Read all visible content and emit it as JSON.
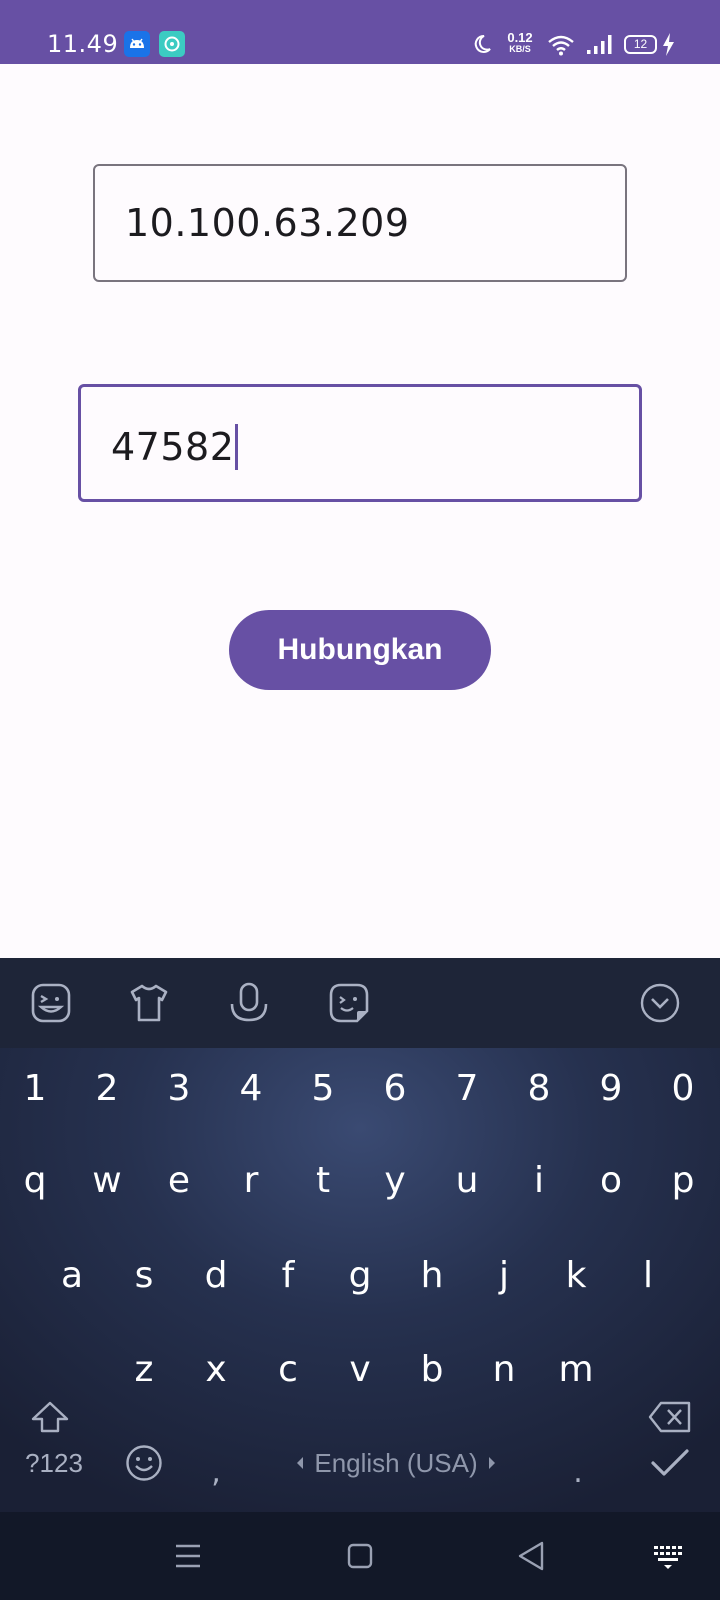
{
  "status_bar": {
    "time": "11.49",
    "net_speed_value": "0.12",
    "net_speed_unit": "KB/S",
    "battery_level": "12",
    "icons": [
      "android-notification-icon",
      "app-notification-icon",
      "moon-icon",
      "wifi-icon",
      "signal-icon",
      "battery-icon",
      "charging-icon"
    ]
  },
  "form": {
    "ip_value": "10.100.63.209",
    "port_value": "47582",
    "connect_label": "Hubungkan"
  },
  "keyboard": {
    "toolbar_icons": [
      "sticker-icon",
      "theme-icon",
      "microphone-icon",
      "emoji-sticker-icon",
      "collapse-keyboard-icon"
    ],
    "numbers": [
      "1",
      "2",
      "3",
      "4",
      "5",
      "6",
      "7",
      "8",
      "9",
      "0"
    ],
    "row1": [
      "q",
      "w",
      "e",
      "r",
      "t",
      "y",
      "u",
      "i",
      "o",
      "p"
    ],
    "row2": [
      "a",
      "s",
      "d",
      "f",
      "g",
      "h",
      "j",
      "k",
      "l"
    ],
    "row3": [
      "z",
      "x",
      "c",
      "v",
      "b",
      "n",
      "m"
    ],
    "symbols_label": "?123",
    "comma": ",",
    "period": ".",
    "space_label": "English (USA)"
  },
  "colors": {
    "primary": "#6750a4",
    "background": "#fefbfe",
    "keyboard_bg": "#1a2035"
  }
}
